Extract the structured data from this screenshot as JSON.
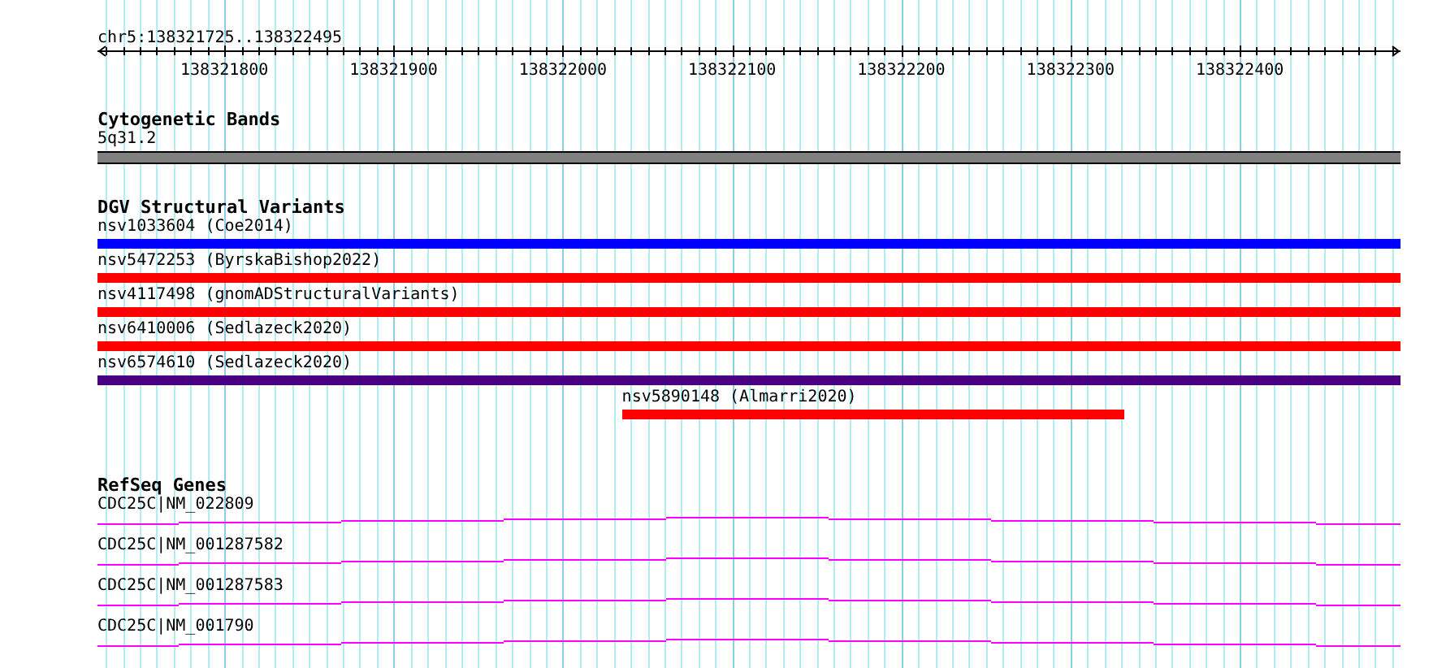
{
  "ruler": {
    "range": "chr5:138321725..138322495",
    "tick_labels": [
      "138321800",
      "138321900",
      "138322000",
      "138322100",
      "138322200",
      "138322300",
      "138322400"
    ]
  },
  "tracks": [
    {
      "kind": "band",
      "title": "Cytogenetic Bands",
      "features": [
        {
          "label": "5q31.2"
        }
      ]
    },
    {
      "kind": "variant",
      "title": "DGV Structural Variants",
      "features": [
        {
          "label": "nsv1033604 (Coe2014)",
          "color": "#0000ff"
        },
        {
          "label": "nsv5472253 (ByrskaBishop2022)",
          "color": "#ff0000"
        },
        {
          "label": "nsv4117498 (gnomADStructuralVariants)",
          "color": "#ff0000"
        },
        {
          "label": "nsv6410006 (Sedlazeck2020)",
          "color": "#ff0000"
        },
        {
          "label": "nsv6574610 (Sedlazeck2020)",
          "color": "#4b0082"
        },
        {
          "label": "nsv5890148 (Almarri2020)",
          "color": "#ff0000"
        }
      ]
    },
    {
      "kind": "gene",
      "title": "RefSeq Genes",
      "features": [
        {
          "label": "CDC25C|NM_022809"
        },
        {
          "label": "CDC25C|NM_001287582"
        },
        {
          "label": "CDC25C|NM_001287583"
        },
        {
          "label": "CDC25C|NM_001790"
        }
      ]
    }
  ]
}
